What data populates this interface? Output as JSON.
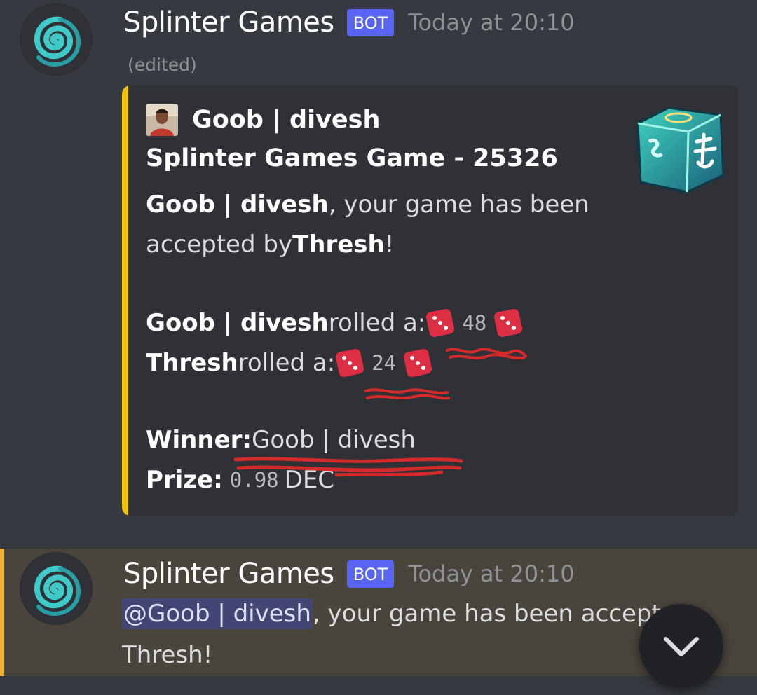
{
  "messages": [
    {
      "username": "Splinter Games",
      "bot_tag": "BOT",
      "timestamp": "Today at 20:10",
      "edited": "(edited)",
      "embed": {
        "accent_color": "#f1c40f",
        "author": "Goob | divesh",
        "title": "Splinter Games Game - 25326",
        "line1_bold": "Goob | divesh",
        "line1_text": ", your game has been",
        "line2_text": "accepted by ",
        "line2_bold": "Thresh",
        "line2_end": "!",
        "roll1_name": "Goob | divesh",
        "roll1_text": " rolled a: ",
        "roll1_value": "48",
        "roll2_name": "Thresh",
        "roll2_text": " rolled a: ",
        "roll2_value": "24",
        "winner_label": "Winner:",
        "winner_value": " Goob | divesh",
        "prize_label": "Prize:",
        "prize_value": "0.98",
        "prize_unit": "DEC"
      }
    },
    {
      "username": "Splinter Games",
      "bot_tag": "BOT",
      "timestamp": "Today at 20:10",
      "mention": "@Goob | divesh",
      "text": ", your game has been accept",
      "line2": "Thresh!"
    }
  ],
  "icons": {
    "avatar": "swirl-icon",
    "author_icon": "profile-photo",
    "thumbnail": "dice-cube-icon",
    "die": "red-die-icon",
    "jump": "chevron-down-icon"
  },
  "colors": {
    "background": "#36393f",
    "embed_bg": "#2f3136",
    "bot_tag": "#5865f2",
    "highlight_bar": "#f0b132",
    "mention_bg": "#414675",
    "scribble": "#d42a2a"
  }
}
